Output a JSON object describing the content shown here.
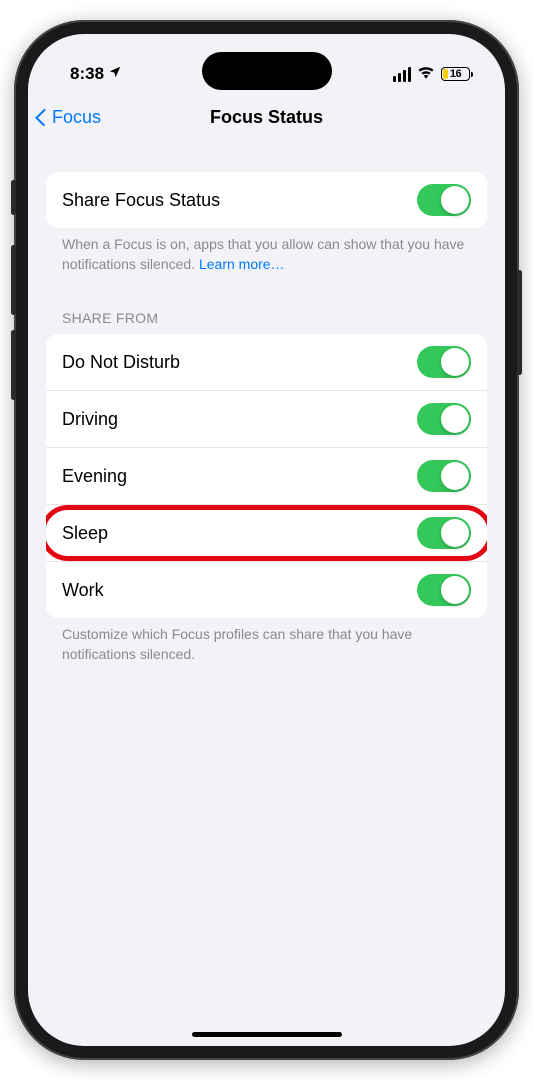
{
  "status": {
    "time": "8:38",
    "battery_percent": "16"
  },
  "nav": {
    "back_label": "Focus",
    "title": "Focus Status"
  },
  "share_section": {
    "label": "Share Focus Status",
    "footer_text": "When a Focus is on, apps that you allow can show that you have notifications silenced. ",
    "learn_more": "Learn more…"
  },
  "share_from": {
    "header": "SHARE FROM",
    "items": [
      {
        "label": "Do Not Disturb",
        "highlight": false
      },
      {
        "label": "Driving",
        "highlight": false
      },
      {
        "label": "Evening",
        "highlight": false
      },
      {
        "label": "Sleep",
        "highlight": true
      },
      {
        "label": "Work",
        "highlight": false
      }
    ],
    "footer": "Customize which Focus profiles can share that you have notifications silenced."
  }
}
